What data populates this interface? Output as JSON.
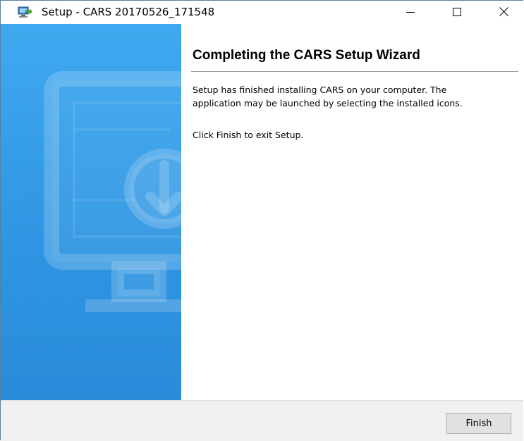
{
  "window": {
    "title": "Setup - CARS 20170526_171548"
  },
  "title_bar": {
    "app_icon": "setup-installer-icon",
    "minimize_icon": "minimize-icon",
    "maximize_icon": "maximize-icon",
    "close_icon": "close-icon"
  },
  "sidebar": {
    "illustration": "monitor-download-icon",
    "color": "#3fa9f0"
  },
  "main": {
    "heading": "Completing the CARS Setup Wizard",
    "paragraph1_line1": "Setup has finished installing CARS on your computer. The",
    "paragraph1_line2": "application may be launched by selecting the installed icons.",
    "paragraph2": "Click Finish to exit Setup."
  },
  "footer": {
    "finish_label": "Finish"
  }
}
